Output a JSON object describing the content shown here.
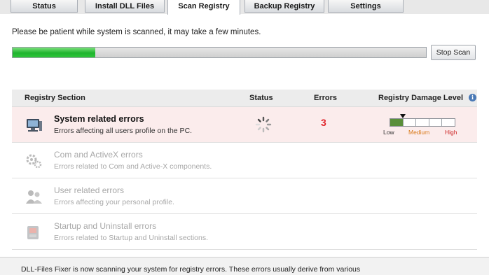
{
  "tabs": [
    {
      "label": "Status",
      "active": false
    },
    {
      "label": "Install DLL Files",
      "active": false
    },
    {
      "label": "Scan Registry",
      "active": true
    },
    {
      "label": "Backup Registry",
      "active": false
    },
    {
      "label": "Settings",
      "active": false
    }
  ],
  "scan": {
    "message": "Please be patient while system is scanned, it may take a few minutes.",
    "progress_fraction": 0.2,
    "stop_label": "Stop Scan"
  },
  "table": {
    "headers": {
      "section": "Registry Section",
      "status": "Status",
      "errors": "Errors",
      "damage": "Registry Damage Level"
    },
    "rows": [
      {
        "title": "System related errors",
        "desc": "Errors affecting all users profile on the PC.",
        "active": true,
        "icon": "computer-icon",
        "errors": "3"
      },
      {
        "title": "Com and ActiveX errors",
        "desc": "Errors related to Com and Active-X components.",
        "active": false,
        "icon": "gears-icon"
      },
      {
        "title": "User related errors",
        "desc": "Errors affecting your personal profile.",
        "active": false,
        "icon": "users-icon"
      },
      {
        "title": "Startup and Uninstall errors",
        "desc": "Errors related to Startup and Uninstall sections.",
        "active": false,
        "icon": "startup-uninstall-icon"
      }
    ],
    "damage_levels": {
      "low": "Low",
      "medium": "Medium",
      "high": "High"
    },
    "damage_fraction": 0.2
  },
  "footer": {
    "text": "DLL-Files Fixer is now scanning your system for registry errors. These errors usually derive from various"
  }
}
